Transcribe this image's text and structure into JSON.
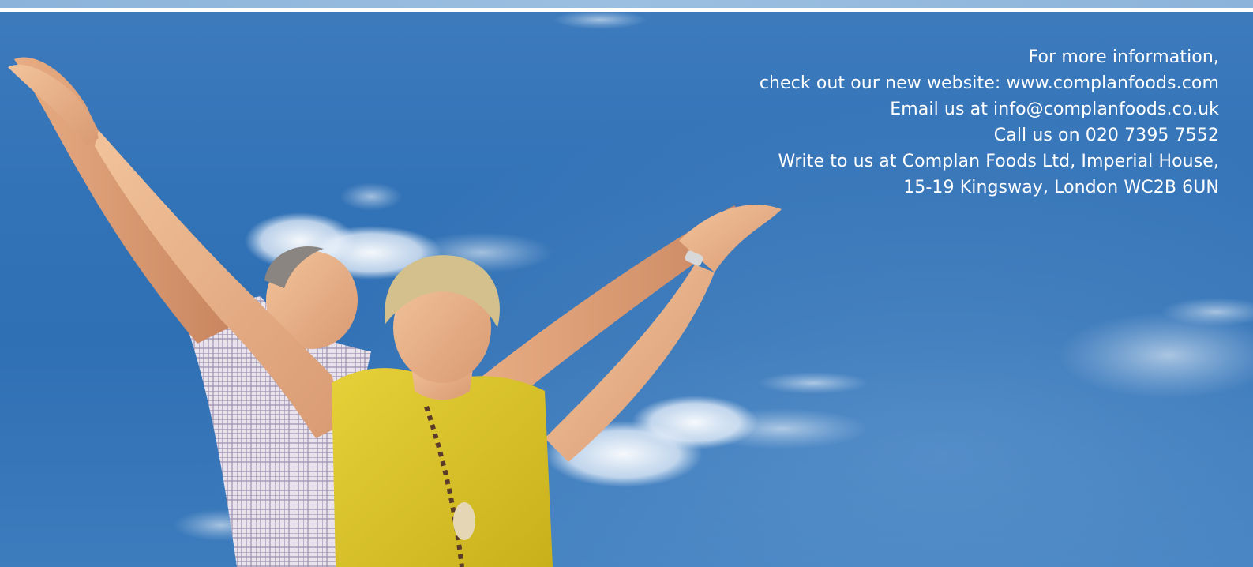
{
  "contact": {
    "lines": [
      "For more information,",
      "check out our new website: www.complanfoods.com",
      "Email us at info@complanfoods.co.uk",
      "Call us on 020 7395 7552",
      "Write to us at Complan Foods Ltd, Imperial House,",
      "15-19 Kingsway, London WC2B 6UN"
    ]
  },
  "colors": {
    "sky": "#3272b6",
    "top_band": "#8cb3da",
    "text": "#ffffff",
    "shirt_yellow": "#d9c21e"
  },
  "illustration": {
    "subject": "couple-arms-raised-under-sky-photo"
  }
}
